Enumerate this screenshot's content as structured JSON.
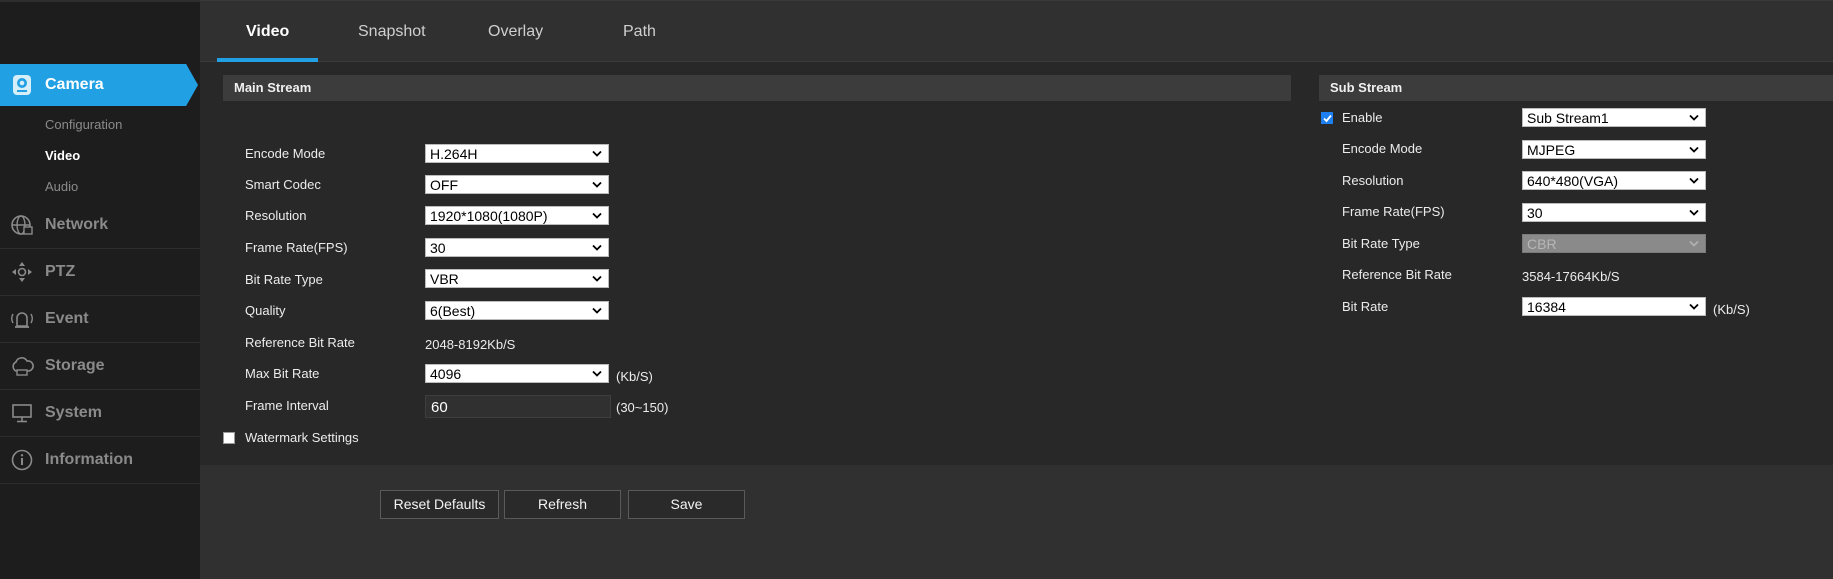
{
  "sidebar": {
    "camera": {
      "label": "Camera",
      "icon": "camera-icon"
    },
    "camera_sub": [
      "Configuration",
      "Video",
      "Audio"
    ],
    "groups": [
      {
        "label": "Network",
        "icon": "network-icon"
      },
      {
        "label": "PTZ",
        "icon": "ptz-icon"
      },
      {
        "label": "Event",
        "icon": "event-icon"
      },
      {
        "label": "Storage",
        "icon": "storage-icon"
      },
      {
        "label": "System",
        "icon": "system-icon"
      },
      {
        "label": "Information",
        "icon": "information-icon"
      }
    ]
  },
  "tabs": [
    "Video",
    "Snapshot",
    "Overlay",
    "Path"
  ],
  "main_stream": {
    "title": "Main Stream",
    "encode_mode": {
      "label": "Encode Mode",
      "value": "H.264H"
    },
    "smart_codec": {
      "label": "Smart Codec",
      "value": "OFF"
    },
    "resolution": {
      "label": "Resolution",
      "value": "1920*1080(1080P)"
    },
    "frame_rate": {
      "label": "Frame Rate(FPS)",
      "value": "30"
    },
    "bit_rate_type": {
      "label": "Bit Rate Type",
      "value": "VBR"
    },
    "quality": {
      "label": "Quality",
      "value": "6(Best)"
    },
    "reference_bit_rate": {
      "label": "Reference Bit Rate",
      "value": "2048-8192Kb/S"
    },
    "max_bit_rate": {
      "label": "Max Bit Rate",
      "value": "4096",
      "unit": "(Kb/S)"
    },
    "frame_interval": {
      "label": "Frame Interval",
      "value": "60",
      "unit": "(30~150)"
    },
    "watermark": {
      "label": "Watermark Settings",
      "checked": false
    }
  },
  "sub_stream": {
    "title": "Sub Stream",
    "enable": {
      "label": "Enable",
      "checked": true,
      "value": "Sub Stream1"
    },
    "encode_mode": {
      "label": "Encode Mode",
      "value": "MJPEG"
    },
    "resolution": {
      "label": "Resolution",
      "value": "640*480(VGA)"
    },
    "frame_rate": {
      "label": "Frame Rate(FPS)",
      "value": "30"
    },
    "bit_rate_type": {
      "label": "Bit Rate Type",
      "value": "CBR"
    },
    "reference_bit_rate": {
      "label": "Reference Bit Rate",
      "value": "3584-17664Kb/S"
    },
    "bit_rate": {
      "label": "Bit Rate",
      "value": "16384",
      "unit": "(Kb/S)"
    }
  },
  "buttons": {
    "reset": "Reset Defaults",
    "refresh": "Refresh",
    "save": "Save"
  },
  "colors": {
    "accent": "#21a0e4",
    "checkbox": "#1e7ff0"
  }
}
